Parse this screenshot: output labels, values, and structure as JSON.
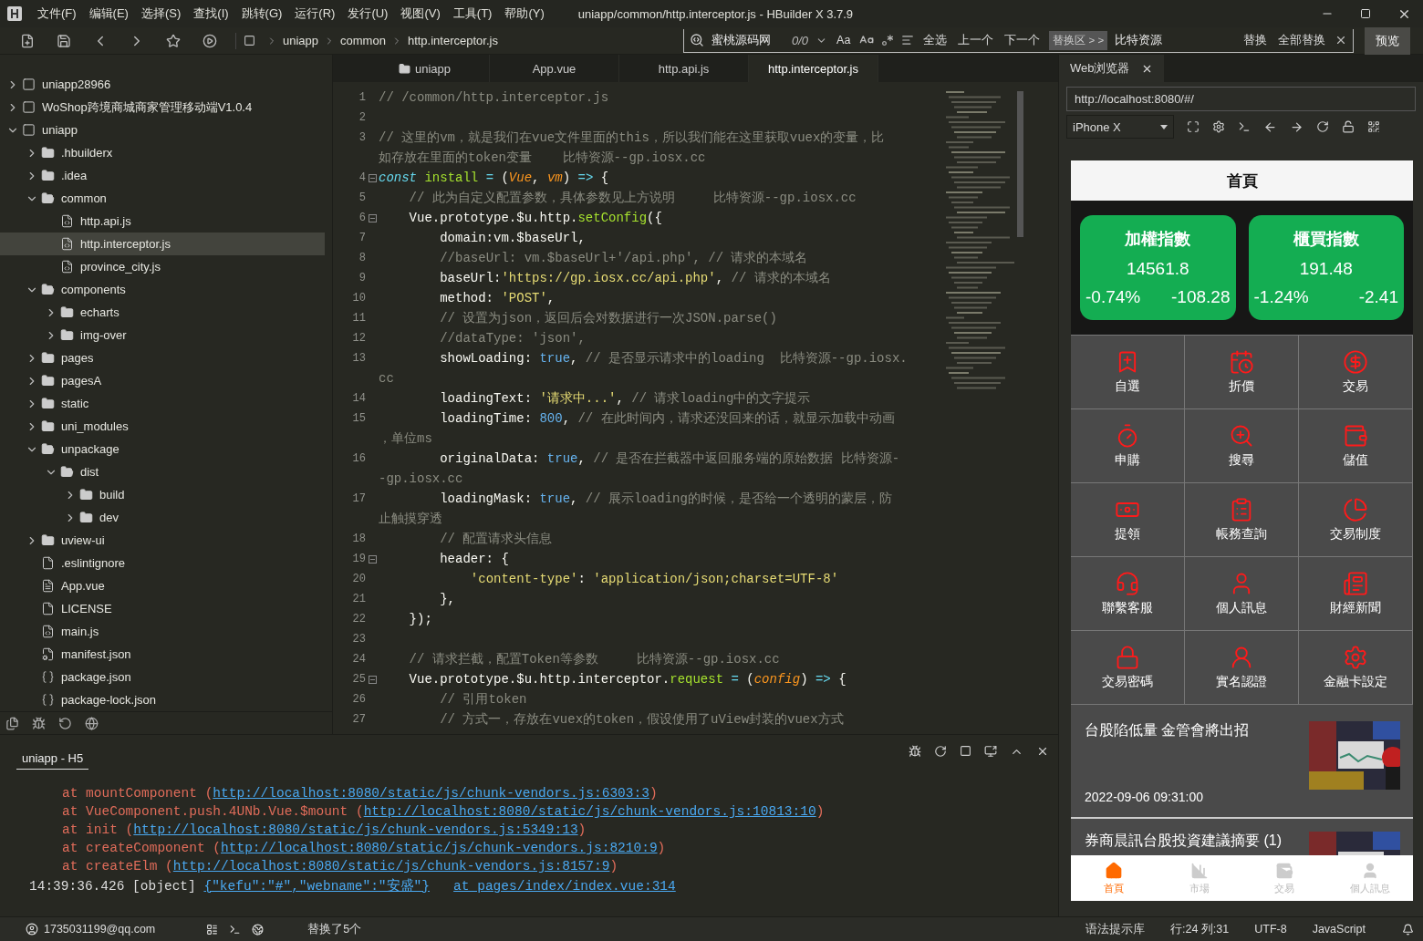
{
  "title_bar": {
    "menu": [
      "文件(F)",
      "编辑(E)",
      "选择(S)",
      "查找(I)",
      "跳转(G)",
      "运行(R)",
      "发行(U)",
      "视图(V)",
      "工具(T)",
      "帮助(Y)"
    ],
    "title": "uniapp/common/http.interceptor.js - HBuilder X 3.7.9"
  },
  "toolbar": {
    "breadcrumb": [
      "uniapp",
      "common",
      "http.interceptor.js"
    ],
    "find": {
      "value": "蜜桃源码网",
      "count": "0/0",
      "case_label": "Aa",
      "actions": [
        "全选",
        "上一个",
        "下一个"
      ],
      "replace_toggle": "替换区 > >",
      "replace_value": "比特资源",
      "replace_actions": [
        "替换",
        "全部替换"
      ]
    },
    "preview_button": "预览"
  },
  "sidebar": {
    "tree": [
      {
        "label": "uniapp28966",
        "kind": "project",
        "expanded": false,
        "selected": false
      },
      {
        "label": "WoShop跨境商城商家管理移动端V1.0.4",
        "kind": "project",
        "expanded": false,
        "selected": false
      },
      {
        "label": "uniapp",
        "kind": "project",
        "expanded": true,
        "selected": false,
        "children": [
          {
            "label": ".hbuilderx",
            "kind": "folder",
            "expanded": false,
            "selected": false
          },
          {
            "label": ".idea",
            "kind": "folder",
            "expanded": false,
            "selected": false
          },
          {
            "label": "common",
            "kind": "folder",
            "expanded": true,
            "selected": false,
            "children": [
              {
                "label": "http.api.js",
                "kind": "script",
                "selected": false
              },
              {
                "label": "http.interceptor.js",
                "kind": "script",
                "selected": true
              },
              {
                "label": "province_city.js",
                "kind": "script",
                "selected": false
              }
            ]
          },
          {
            "label": "components",
            "kind": "folder",
            "expanded": true,
            "selected": false,
            "children": [
              {
                "label": "echarts",
                "kind": "folder",
                "expanded": false,
                "selected": false
              },
              {
                "label": "img-over",
                "kind": "folder",
                "expanded": false,
                "selected": false
              }
            ]
          },
          {
            "label": "pages",
            "kind": "folder",
            "expanded": false,
            "selected": false
          },
          {
            "label": "pagesA",
            "kind": "folder",
            "expanded": false,
            "selected": false
          },
          {
            "label": "static",
            "kind": "folder",
            "expanded": false,
            "selected": false
          },
          {
            "label": "uni_modules",
            "kind": "folder",
            "expanded": false,
            "selected": false
          },
          {
            "label": "unpackage",
            "kind": "folder",
            "expanded": true,
            "selected": false,
            "children": [
              {
                "label": "dist",
                "kind": "folder",
                "expanded": true,
                "selected": false,
                "children": [
                  {
                    "label": "build",
                    "kind": "folder",
                    "expanded": false,
                    "selected": false
                  },
                  {
                    "label": "dev",
                    "kind": "folder",
                    "expanded": false,
                    "selected": false
                  }
                ]
              }
            ]
          },
          {
            "label": "uview-ui",
            "kind": "folder",
            "expanded": false,
            "selected": false
          },
          {
            "label": ".eslintignore",
            "kind": "plain",
            "selected": false
          },
          {
            "label": "App.vue",
            "kind": "vue",
            "selected": false
          },
          {
            "label": "LICENSE",
            "kind": "plain",
            "selected": false
          },
          {
            "label": "main.js",
            "kind": "script",
            "selected": false
          },
          {
            "label": "manifest.json",
            "kind": "config",
            "selected": false
          },
          {
            "label": "package.json",
            "kind": "brackets",
            "selected": false
          },
          {
            "label": "package-lock.json",
            "kind": "brackets",
            "selected": false
          }
        ]
      }
    ]
  },
  "editor": {
    "tabs": [
      {
        "label": "uniapp",
        "kind": "folder",
        "selected": false
      },
      {
        "label": "App.vue",
        "kind": "file",
        "selected": false
      },
      {
        "label": "http.api.js",
        "kind": "file",
        "selected": false
      },
      {
        "label": "http.interceptor.js",
        "kind": "file",
        "selected": true
      }
    ],
    "lines": [
      {
        "num": "1",
        "fold": false,
        "rows": [
          [
            {
              "kind": "comment",
              "text": "// /common/http.interceptor.js"
            }
          ]
        ]
      },
      {
        "num": "2",
        "fold": false
      },
      {
        "num": "3",
        "fold": false,
        "rows": [
          [
            {
              "kind": "comment",
              "text": "// 这里的vm，就是我们在vue文件里面的this，所以我们能在这里获取vuex的变量，比"
            }
          ],
          [
            {
              "kind": "comment",
              "text": "如存放在里面的token变量    比特资源--gp.iosx.cc"
            }
          ]
        ]
      },
      {
        "num": "4",
        "fold": true,
        "rows": [
          [
            {
              "kind": "keyword",
              "text": "const"
            },
            {
              "kind": "plain",
              "text": " "
            },
            {
              "kind": "name",
              "text": "install"
            },
            {
              "kind": "op",
              "text": " = "
            },
            {
              "kind": "plain",
              "text": "("
            },
            {
              "kind": "param",
              "text": "Vue"
            },
            {
              "kind": "plain",
              "text": ", "
            },
            {
              "kind": "param",
              "text": "vm"
            },
            {
              "kind": "plain",
              "text": ")"
            },
            {
              "kind": "op",
              "text": " => "
            },
            {
              "kind": "plain",
              "text": "{"
            }
          ]
        ]
      },
      {
        "num": "5",
        "fold": false,
        "rows": [
          [
            {
              "kind": "plain",
              "text": "    "
            },
            {
              "kind": "comment",
              "text": "// 此为自定义配置参数，具体参数见上方说明     比特资源--gp.iosx.cc"
            }
          ]
        ]
      },
      {
        "num": "6",
        "fold": true,
        "rows": [
          [
            {
              "kind": "plain",
              "text": "    Vue.prototype.$u.http."
            },
            {
              "kind": "name",
              "text": "setConfig"
            },
            {
              "kind": "plain",
              "text": "({"
            }
          ]
        ]
      },
      {
        "num": "7",
        "fold": false,
        "rows": [
          [
            {
              "kind": "plain",
              "text": "        domain:vm.$baseUrl,"
            }
          ]
        ]
      },
      {
        "num": "8",
        "fold": false,
        "rows": [
          [
            {
              "kind": "plain",
              "text": "        "
            },
            {
              "kind": "comment",
              "text": "//baseUrl: vm.$baseUrl+'/api.php', // 请求的本域名"
            }
          ]
        ]
      },
      {
        "num": "9",
        "fold": false,
        "rows": [
          [
            {
              "kind": "plain",
              "text": "        baseUrl:"
            },
            {
              "kind": "string",
              "text": "'https://gp.iosx.cc/api.php'"
            },
            {
              "kind": "plain",
              "text": ", "
            },
            {
              "kind": "comment",
              "text": "// 请求的本域名"
            }
          ]
        ]
      },
      {
        "num": "10",
        "fold": false,
        "rows": [
          [
            {
              "kind": "plain",
              "text": "        method: "
            },
            {
              "kind": "string",
              "text": "'POST'"
            },
            {
              "kind": "plain",
              "text": ","
            }
          ]
        ]
      },
      {
        "num": "11",
        "fold": false,
        "rows": [
          [
            {
              "kind": "plain",
              "text": "        "
            },
            {
              "kind": "comment",
              "text": "// 设置为json，返回后会对数据进行一次JSON.parse()"
            }
          ]
        ]
      },
      {
        "num": "12",
        "fold": false,
        "rows": [
          [
            {
              "kind": "plain",
              "text": "        "
            },
            {
              "kind": "comment",
              "text": "//dataType: 'json',"
            }
          ]
        ]
      },
      {
        "num": "13",
        "fold": false,
        "rows": [
          [
            {
              "kind": "plain",
              "text": "        showLoading: "
            },
            {
              "kind": "literal",
              "text": "true"
            },
            {
              "kind": "plain",
              "text": ", "
            },
            {
              "kind": "comment",
              "text": "// 是否显示请求中的loading  比特资源--gp.iosx."
            }
          ],
          [
            {
              "kind": "comment",
              "text": "cc"
            }
          ]
        ]
      },
      {
        "num": "14",
        "fold": false,
        "rows": [
          [
            {
              "kind": "plain",
              "text": "        loadingText: "
            },
            {
              "kind": "string",
              "text": "'请求中...'"
            },
            {
              "kind": "plain",
              "text": ", "
            },
            {
              "kind": "comment",
              "text": "// 请求loading中的文字提示"
            }
          ]
        ]
      },
      {
        "num": "15",
        "fold": false,
        "rows": [
          [
            {
              "kind": "plain",
              "text": "        loadingTime: "
            },
            {
              "kind": "literal",
              "text": "800"
            },
            {
              "kind": "plain",
              "text": ", "
            },
            {
              "kind": "comment",
              "text": "// 在此时间内，请求还没回来的话，就显示加载中动画"
            }
          ],
          [
            {
              "kind": "comment",
              "text": "，单位ms"
            }
          ]
        ]
      },
      {
        "num": "16",
        "fold": false,
        "rows": [
          [
            {
              "kind": "plain",
              "text": "        originalData: "
            },
            {
              "kind": "literal",
              "text": "true"
            },
            {
              "kind": "plain",
              "text": ", "
            },
            {
              "kind": "comment",
              "text": "// 是否在拦截器中返回服务端的原始数据 比特资源-"
            }
          ],
          [
            {
              "kind": "comment",
              "text": "-gp.iosx.cc"
            }
          ]
        ]
      },
      {
        "num": "17",
        "fold": false,
        "rows": [
          [
            {
              "kind": "plain",
              "text": "        loadingMask: "
            },
            {
              "kind": "literal",
              "text": "true"
            },
            {
              "kind": "plain",
              "text": ", "
            },
            {
              "kind": "comment",
              "text": "// 展示loading的时候，是否给一个透明的蒙层，防"
            }
          ],
          [
            {
              "kind": "comment",
              "text": "止触摸穿透"
            }
          ]
        ]
      },
      {
        "num": "18",
        "fold": false,
        "rows": [
          [
            {
              "kind": "plain",
              "text": "        "
            },
            {
              "kind": "comment",
              "text": "// 配置请求头信息"
            }
          ]
        ]
      },
      {
        "num": "19",
        "fold": true,
        "rows": [
          [
            {
              "kind": "plain",
              "text": "        header: {"
            }
          ]
        ]
      },
      {
        "num": "20",
        "fold": false,
        "rows": [
          [
            {
              "kind": "plain",
              "text": "            "
            },
            {
              "kind": "string",
              "text": "'content-type'"
            },
            {
              "kind": "plain",
              "text": ": "
            },
            {
              "kind": "string",
              "text": "'application/json;charset=UTF-8'"
            }
          ]
        ]
      },
      {
        "num": "21",
        "fold": false,
        "rows": [
          [
            {
              "kind": "plain",
              "text": "        },"
            }
          ]
        ]
      },
      {
        "num": "22",
        "fold": false,
        "rows": [
          [
            {
              "kind": "plain",
              "text": "    });"
            }
          ]
        ]
      },
      {
        "num": "23",
        "fold": false
      },
      {
        "num": "24",
        "fold": false,
        "rows": [
          [
            {
              "kind": "plain",
              "text": "    "
            },
            {
              "kind": "comment",
              "text": "// 请求拦截，配置Token等参数     比特资源--gp.iosx.cc"
            }
          ]
        ]
      },
      {
        "num": "25",
        "fold": true,
        "rows": [
          [
            {
              "kind": "plain",
              "text": "    Vue.prototype.$u.http.interceptor."
            },
            {
              "kind": "name",
              "text": "request"
            },
            {
              "kind": "op",
              "text": " = "
            },
            {
              "kind": "plain",
              "text": "("
            },
            {
              "kind": "param",
              "text": "config"
            },
            {
              "kind": "plain",
              "text": ")"
            },
            {
              "kind": "op",
              "text": " => "
            },
            {
              "kind": "plain",
              "text": "{"
            }
          ]
        ]
      },
      {
        "num": "26",
        "fold": false,
        "rows": [
          [
            {
              "kind": "plain",
              "text": "        "
            },
            {
              "kind": "comment",
              "text": "// 引用token"
            }
          ]
        ]
      },
      {
        "num": "27",
        "fold": false,
        "rows": [
          [
            {
              "kind": "plain",
              "text": "        "
            },
            {
              "kind": "comment",
              "text": "// 方式一，存放在vuex的token，假设使用了uView封装的vuex方式"
            }
          ]
        ]
      }
    ]
  },
  "console": {
    "tab": "uniapp - H5",
    "lines": [
      {
        "kind": "trace",
        "text": "at mountComponent (",
        "link": "http://localhost:8080/static/js/chunk-vendors.js:6303:3",
        "end": ")"
      },
      {
        "kind": "trace",
        "text": "at VueComponent.push.4UNb.Vue.$mount (",
        "link": "http://localhost:8080/static/js/chunk-vendors.js:10813:10",
        "end": ")"
      },
      {
        "kind": "trace",
        "text": "at init (",
        "link": "http://localhost:8080/static/js/chunk-vendors.js:5349:13",
        "end": ")"
      },
      {
        "kind": "trace",
        "text": "at createComponent (",
        "link": "http://localhost:8080/static/js/chunk-vendors.js:8210:9",
        "end": ")"
      },
      {
        "kind": "trace",
        "text": "at createElm (",
        "link": "http://localhost:8080/static/js/chunk-vendors.js:8157:9",
        "end": ")"
      },
      {
        "kind": "log",
        "text": "14:39:36.426 [object] ",
        "link": "{\"kefu\":\"#\",\"webname\":\"安盛\"}",
        "source": "at pages/index/index.vue:314"
      }
    ]
  },
  "browser": {
    "tab": "Web浏览器",
    "url": "http://localhost:8080/#/",
    "device": "iPhone X",
    "app": {
      "header": "首頁",
      "indices": [
        {
          "name": "加權指數",
          "value": "14561.8",
          "percent": "-0.74%",
          "change": "-108.28"
        },
        {
          "name": "櫃買指數",
          "value": "191.48",
          "percent": "-1.24%",
          "change": "-2.41"
        }
      ],
      "menu": [
        "自選",
        "折價",
        "交易",
        "申購",
        "搜尋",
        "儲值",
        "提領",
        "帳務查詢",
        "交易制度",
        "聯繫客服",
        "個人訊息",
        "財經新聞",
        "交易密碼",
        "實名認證",
        "金融卡設定"
      ],
      "news": [
        {
          "title": "台股陷低量 金管會將出招",
          "time": "2022-09-06 09:31:00"
        },
        {
          "title": "券商晨訊台股投資建議摘要 (1)"
        }
      ],
      "tabbar": [
        {
          "label": "首頁",
          "selected": true
        },
        {
          "label": "市場",
          "selected": false
        },
        {
          "label": "交易",
          "selected": false
        },
        {
          "label": "個人訊息",
          "selected": false
        }
      ]
    }
  },
  "status_bar": {
    "account": "1735031199@qq.com",
    "message": "替换了5个",
    "items": [
      "语法提示库",
      "行:24  列:31",
      "UTF-8",
      "JavaScript"
    ]
  }
}
